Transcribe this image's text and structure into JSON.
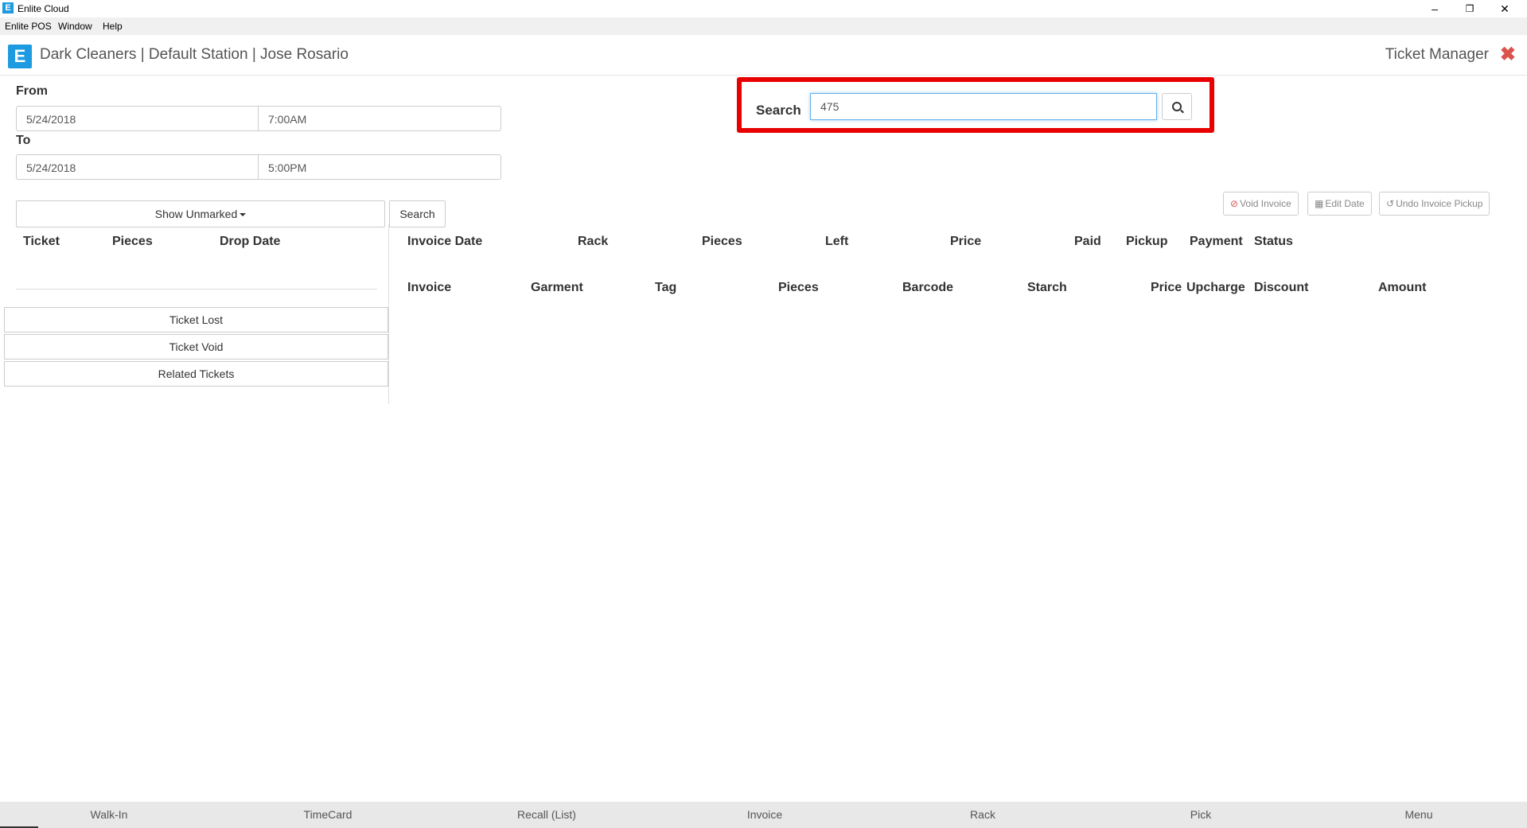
{
  "window": {
    "title": "Enlite Cloud",
    "minimize": "–",
    "restore": "❐",
    "close": "✕"
  },
  "menu": [
    "Enlite POS",
    "Window",
    "Help"
  ],
  "header": {
    "logo": "E",
    "brand": "Dark Cleaners | Default Station | Jose Rosario",
    "page_title": "Ticket Manager",
    "close": "✖"
  },
  "filters": {
    "from_label": "From",
    "from_date": "5/24/2018",
    "from_time": "7:00AM",
    "to_label": "To",
    "to_date": "5/24/2018",
    "to_time": "5:00PM"
  },
  "search": {
    "label": "Search",
    "value": "475",
    "icon": "search-icon"
  },
  "left_panel": {
    "dropdown": "Show Unmarked",
    "search_button": "Search",
    "columns": [
      "Ticket",
      "Pieces",
      "Drop Date"
    ],
    "buttons": [
      "Ticket Lost",
      "Ticket Void",
      "Related Tickets"
    ]
  },
  "actions": {
    "void_invoice": "Void Invoice",
    "edit_date": "Edit Date",
    "undo_pickup": "Undo Invoice Pickup",
    "void_icon": "ban-icon",
    "edit_icon": "calendar-icon",
    "undo_icon": "undo-icon"
  },
  "invoice_columns": [
    "Invoice Date",
    "Rack",
    "Pieces",
    "Left",
    "Price",
    "Paid",
    "Pickup",
    "Payment",
    "Status"
  ],
  "garment_columns": [
    "Invoice",
    "Garment",
    "Tag",
    "Pieces",
    "Barcode",
    "Starch",
    "Price",
    "Upcharge",
    "Discount",
    "Amount"
  ],
  "bottom_nav": [
    "Walk-In",
    "TimeCard",
    "Recall (List)",
    "Invoice",
    "Rack",
    "Pick",
    "Menu"
  ],
  "colors": {
    "brand": "#1e9be0",
    "highlight": "#e80000",
    "close": "#d9534f"
  }
}
